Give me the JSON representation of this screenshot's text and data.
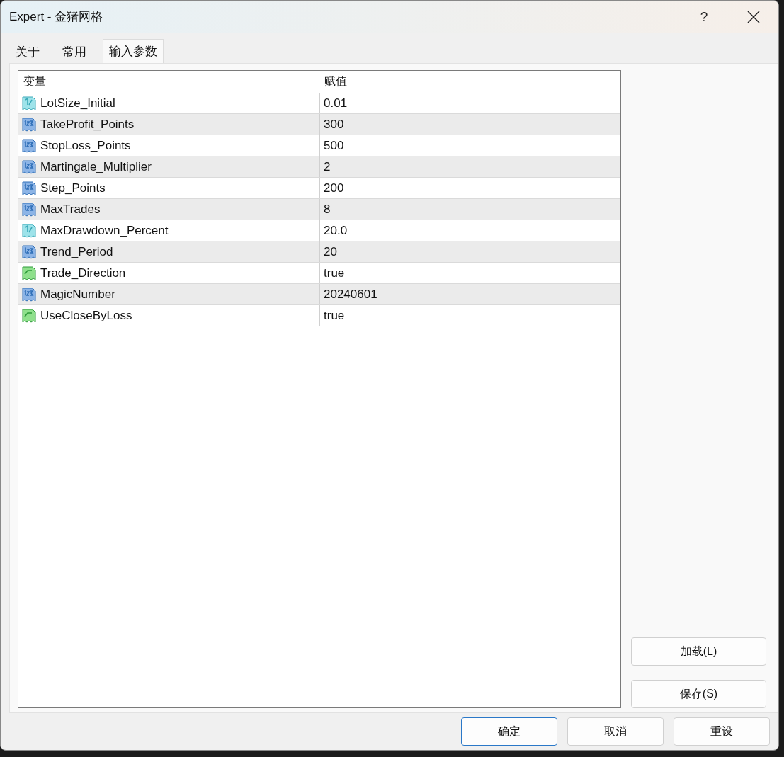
{
  "window": {
    "title": "Expert - 金猪网格",
    "help": "?"
  },
  "tabs": [
    {
      "label": "关于",
      "selected": false
    },
    {
      "label": "常用",
      "selected": false
    },
    {
      "label": "输入参数",
      "selected": true
    }
  ],
  "table": {
    "columns": [
      "变量",
      "赋值"
    ],
    "rows": [
      {
        "kind": "double",
        "name": "LotSize_Initial",
        "value": "0.01"
      },
      {
        "kind": "int",
        "name": "TakeProfit_Points",
        "value": "300"
      },
      {
        "kind": "int",
        "name": "StopLoss_Points",
        "value": "500"
      },
      {
        "kind": "int",
        "name": "Martingale_Multiplier",
        "value": "2"
      },
      {
        "kind": "int",
        "name": "Step_Points",
        "value": "200"
      },
      {
        "kind": "int",
        "name": "MaxTrades",
        "value": "8"
      },
      {
        "kind": "double",
        "name": "MaxDrawdown_Percent",
        "value": "20.0"
      },
      {
        "kind": "int",
        "name": "Trend_Period",
        "value": "20"
      },
      {
        "kind": "bool",
        "name": "Trade_Direction",
        "value": "true"
      },
      {
        "kind": "int",
        "name": "MagicNumber",
        "value": "20240601"
      },
      {
        "kind": "bool",
        "name": "UseCloseByLoss",
        "value": "true"
      }
    ]
  },
  "side_buttons": [
    "加载(L)",
    "保存(S)"
  ],
  "buttons": [
    {
      "label": "确定",
      "default": true
    },
    {
      "label": "取消",
      "default": false
    },
    {
      "label": "重设",
      "default": false
    }
  ]
}
